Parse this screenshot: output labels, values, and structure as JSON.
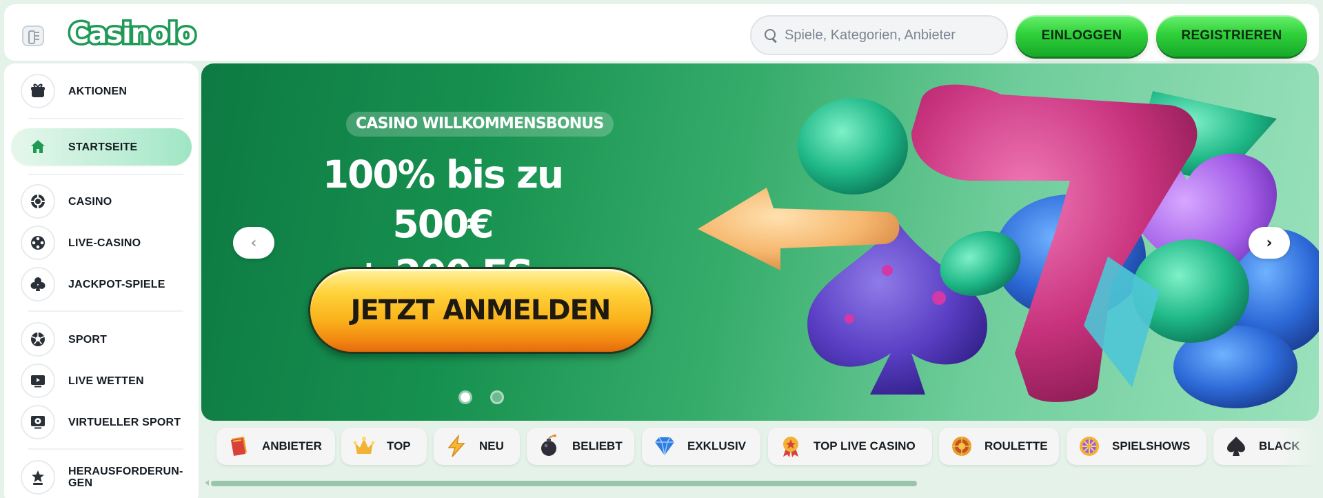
{
  "header": {
    "logo_text": "Casinolo",
    "search_placeholder": "Spiele, Kategorien, Anbieter",
    "login_label": "EINLOGGEN",
    "register_label": "REGISTRIEREN"
  },
  "sidebar": {
    "items": [
      {
        "label": "AKTIONEN",
        "icon": "gift-box-icon"
      },
      {
        "label": "STARTSEITE",
        "icon": "home-icon",
        "active": true
      },
      {
        "label": "CASINO",
        "icon": "casino-chip-icon"
      },
      {
        "label": "LIVE-CASINO",
        "icon": "film-reel-icon"
      },
      {
        "label": "JACKPOT-SPIELE",
        "icon": "club-icon"
      },
      {
        "label": "SPORT",
        "icon": "soccer-ball-icon"
      },
      {
        "label": "LIVE WETTEN",
        "icon": "tv-play-icon"
      },
      {
        "label": "VIRTUELLER SPORT",
        "icon": "monitor-ball-icon"
      },
      {
        "label": "HERAUSFORDERUN-GEN",
        "icon": "star-trophy-icon"
      }
    ]
  },
  "banner": {
    "tag": "CASINO WILLKOMMENSBONUS",
    "headline_line1": "100% bis zu 500€",
    "headline_line2": "+ 200 FS",
    "cta_label": "JETZT ANMELDEN",
    "prev_arrow": "‹",
    "next_arrow": "›",
    "slides_total": 2,
    "active_slide": 1
  },
  "categories": [
    {
      "label": "ANBIETER",
      "icon": "book-icon"
    },
    {
      "label": "TOP",
      "icon": "crown-icon"
    },
    {
      "label": "NEU",
      "icon": "lightning-icon"
    },
    {
      "label": "BELIEBT",
      "icon": "bomb-icon"
    },
    {
      "label": "EXKLUSIV",
      "icon": "diamond-icon"
    },
    {
      "label": "TOP LIVE CASINO",
      "icon": "medal-icon"
    },
    {
      "label": "ROULETTE",
      "icon": "roulette-icon"
    },
    {
      "label": "SPIELSHOWS",
      "icon": "wheel-icon"
    },
    {
      "label": "BLACK",
      "icon": "spade-icon"
    }
  ],
  "scrollbar": {
    "thumb_fraction": 0.64
  },
  "colors": {
    "brand_green": "#1f9a57",
    "button_green": "#2fd13a",
    "page_bg": "#e4f2e9",
    "cta_orange": "#fab21c"
  }
}
